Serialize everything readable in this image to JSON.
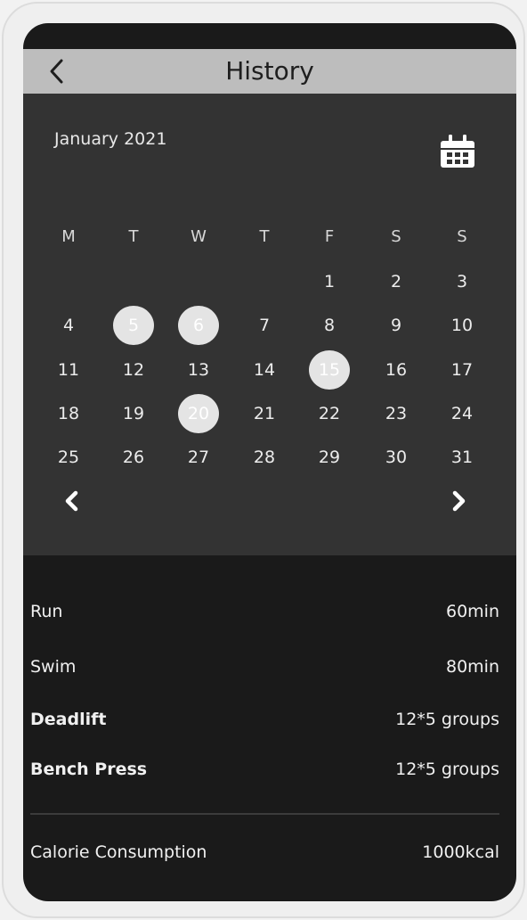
{
  "header": {
    "title": "History",
    "back_icon": "chevron-left-icon"
  },
  "calendar": {
    "month": "January 2021",
    "calendar_icon": "calendar-icon",
    "weekdays": [
      "M",
      "T",
      "W",
      "T",
      "F",
      "S",
      "S"
    ],
    "weeks": [
      [
        "",
        "",
        "",
        "",
        "1",
        "2",
        "3"
      ],
      [
        "4",
        "5",
        "6",
        "7",
        "8",
        "9",
        "10"
      ],
      [
        "11",
        "12",
        "13",
        "14",
        "15",
        "16",
        "17"
      ],
      [
        "18",
        "19",
        "20",
        "21",
        "22",
        "23",
        "24"
      ],
      [
        "25",
        "26",
        "27",
        "28",
        "29",
        "30",
        "31"
      ]
    ],
    "highlighted_days": [
      "5",
      "6",
      "15",
      "20"
    ],
    "prev_icon": "chevron-left-icon",
    "next_icon": "chevron-right-icon"
  },
  "activities": [
    {
      "label": "Run",
      "value": "60min",
      "bold": false
    },
    {
      "label": "Swim",
      "value": "80min",
      "bold": false
    },
    {
      "label": "Deadlift",
      "value": "12*5 groups",
      "bold": true
    },
    {
      "label": "Bench Press",
      "value": "12*5 groups",
      "bold": true
    }
  ],
  "summary": {
    "label": "Calorie Consumption",
    "value": "1000kcal"
  },
  "colors": {
    "screen_bg": "#1a1a1a",
    "calendar_bg": "#333333",
    "header_bg": "#bdbdbd",
    "highlight": "#e4e4e4"
  }
}
